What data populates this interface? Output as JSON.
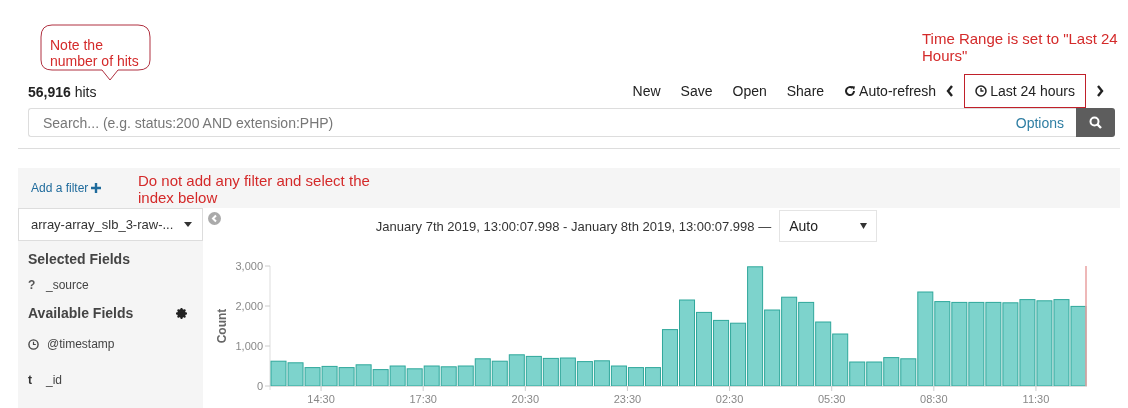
{
  "annotations": [
    {
      "kind": "bubble",
      "text": "Note the number of hits"
    },
    {
      "kind": "plain",
      "text": "Time Range is set to \"Last 24 Hours\""
    },
    {
      "kind": "plain-left",
      "text": "Do not add any filter and select the index below"
    }
  ],
  "hits": {
    "count": "56,916",
    "label": "hits"
  },
  "nav": [
    {
      "kind": "link",
      "label": "New"
    },
    {
      "kind": "link",
      "label": "Save"
    },
    {
      "kind": "link",
      "label": "Open"
    },
    {
      "kind": "link",
      "label": "Share"
    },
    {
      "kind": "refresh",
      "label": "Auto-refresh"
    }
  ],
  "time_range": {
    "label": "Last 24 hours",
    "highlighted": true
  },
  "search": {
    "placeholder": "Search... (e.g. status:200 AND extension:PHP)",
    "options_label": "Options"
  },
  "filter_bar": {
    "add_label": "Add a filter"
  },
  "sidebar": {
    "index_pattern": "array-array_slb_3-raw-...",
    "selected_title": "Selected Fields",
    "selected_fields": [
      {
        "kind": "unknown",
        "type_label": "?",
        "name": "_source"
      }
    ],
    "available_title": "Available Fields",
    "available_fields": [
      {
        "kind": "date",
        "name": "@timestamp"
      },
      {
        "kind": "string",
        "type_label": "t",
        "name": "_id"
      }
    ]
  },
  "chart": {
    "date_range": "January 7th 2019, 13:00:07.998 - January 8th 2019, 13:00:07.998 —",
    "interval": "Auto",
    "chart_data": {
      "type": "bar",
      "ylabel": "Count",
      "categories": [
        null,
        null,
        null,
        "14:30",
        null,
        null,
        null,
        null,
        null,
        "17:30",
        null,
        null,
        null,
        null,
        null,
        "20:30",
        null,
        null,
        null,
        null,
        null,
        "23:30",
        null,
        null,
        null,
        null,
        null,
        "02:30",
        null,
        null,
        null,
        null,
        null,
        "05:30",
        null,
        null,
        null,
        null,
        null,
        "08:30",
        null,
        null,
        null,
        null,
        null,
        "11:30",
        null,
        null
      ],
      "values": [
        620,
        580,
        460,
        490,
        460,
        530,
        410,
        500,
        430,
        500,
        480,
        500,
        680,
        620,
        780,
        740,
        690,
        700,
        610,
        630,
        500,
        460,
        460,
        1410,
        2150,
        1840,
        1640,
        1570,
        2980,
        1900,
        2220,
        2090,
        1600,
        1300,
        600,
        600,
        710,
        680,
        2350,
        2110,
        2090,
        2090,
        2090,
        2080,
        2160,
        2130,
        2160,
        1990
      ],
      "ylim": [
        0,
        3000
      ],
      "yticks": [
        {
          "value": 0,
          "label": "0"
        },
        {
          "value": 1000,
          "label": "1,000"
        },
        {
          "value": 2000,
          "label": "2,000"
        },
        {
          "value": 3000,
          "label": "3,000"
        }
      ]
    }
  }
}
